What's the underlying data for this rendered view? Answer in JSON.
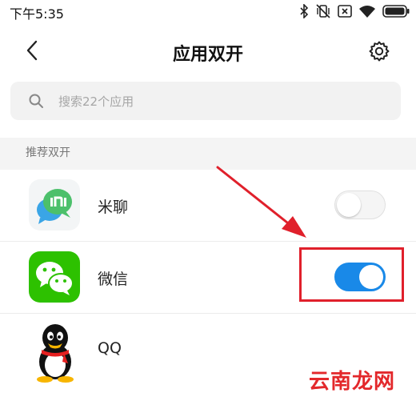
{
  "status_bar": {
    "time": "下午5:35",
    "icons": [
      "bluetooth-icon",
      "vibrate-off-icon",
      "close-box-icon",
      "wifi-icon",
      "battery-icon"
    ]
  },
  "header": {
    "title": "应用双开",
    "back_icon": "chevron-left-icon",
    "settings_icon": "gear-icon"
  },
  "search": {
    "placeholder": "搜索22个应用"
  },
  "section": {
    "title": "推荐双开"
  },
  "apps": [
    {
      "name": "米聊",
      "icon": "mi-talk-icon",
      "enabled": false
    },
    {
      "name": "微信",
      "icon": "wechat-icon",
      "enabled": true
    },
    {
      "name": "QQ",
      "icon": "qq-icon",
      "enabled": false
    }
  ],
  "watermark": "云南龙网",
  "colors": {
    "toggle_on": "#1989e8",
    "annotation_red": "#e0202b",
    "wechat_green": "#2dc100"
  }
}
